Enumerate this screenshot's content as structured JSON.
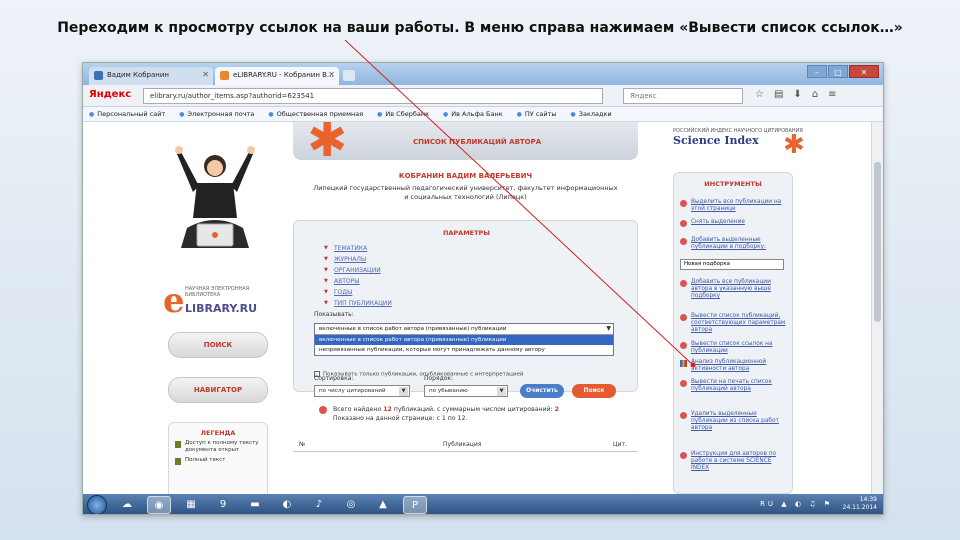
{
  "caption": "Переходим к просмотру ссылок на ваши работы. В меню справа нажимаем «Вывести список ссылок…»",
  "browser": {
    "tabs": [
      {
        "label": "Вадим Кобранин",
        "close": "✕"
      },
      {
        "label": "eLIBRARY.RU - Кобранин В...",
        "close": "✕"
      }
    ],
    "window_buttons": {
      "minimize": "–",
      "maximize": "□",
      "close": "✕"
    },
    "yandex": "Яндекс",
    "url": "elibrary.ru/author_items.asp?authorid=623541",
    "search_placeholder": "Яндекс",
    "bookmarks": [
      "Персональный сайт",
      "Электронная почта",
      "Общественная приемная",
      "Ив Сбербанк",
      "Ив Альфа Банк",
      "ПУ сайты",
      "Закладки"
    ]
  },
  "left": {
    "logo_tagline": "НАУЧНАЯ ЭЛЕКТРОННАЯ БИБЛИОТЕКА",
    "logo_e": "e",
    "logo_name": "LIBRARY.RU",
    "search_button": "ПОИСК",
    "navigator_button": "НАВИГАТОР",
    "legend_title": "ЛЕГЕНДА",
    "legend_items": [
      "Доступ к полному тексту документа открыт",
      "Полный текст"
    ]
  },
  "main": {
    "banner_title": "СПИСОК ПУБЛИКАЦИЙ АВТОРА",
    "author_name": "КОБРАНИН ВАДИМ ВАЛЕРЬЕВИЧ",
    "author_org": "Липецкий государственный педагогический университет, факультет информационных и социальных технологий (Липецк)",
    "params_title": "ПАРАМЕТРЫ",
    "param_links": [
      "ТЕМАТИКА",
      "ЖУРНАЛЫ",
      "ОРГАНИЗАЦИИ",
      "АВТОРЫ",
      "ГОДЫ",
      "ТИП ПУБЛИКАЦИИ"
    ],
    "show_label": "Показывать:",
    "select_current": "включенные в список работ автора (привязанные) публикации",
    "select_options": [
      "включенные в список работ автора (привязанные) публикации",
      "непривязанные публикации, которые могут принадлежать данному автору"
    ],
    "checkbox_label": "Показывать только публикации, опубликованные с интерпретацией",
    "sort_label": "Сортировка:",
    "sort_value": "по числу цитирований",
    "order_label": "Порядок:",
    "order_value": "по убыванию",
    "clear_button": "Очистить",
    "search_button": "Поиск",
    "found_line1_prefix": "Всего найдено ",
    "found_count": "12",
    "found_line1_suffix": " публикаций, с суммарным числом цитирований: ",
    "found_citations": "2",
    "found_line2": "Показано на данной странице: с 1 по 12.",
    "table_headers": [
      "№",
      "Публикация",
      "Цит."
    ]
  },
  "right": {
    "logo_small": "РОССИЙСКИЙ ИНДЕКС НАУЧНОГО ЦИТИРОВАНИЯ",
    "logo_big": "Science Index",
    "tools_title": "ИНСТРУМЕНТЫ",
    "tools": [
      "Выделить все публикации на этой странице",
      "Снять выделение",
      "Добавить выделенные публикации в подборку:",
      "Добавить все публикации автора в указанную выше подборку",
      "Вывести список публикаций, соответствующих параметрам автора",
      "Вывести список ссылок на публикации",
      "Анализ публикационной активности автора",
      "Вывести на печать список публикаций автора",
      "Удалить выделенные публикации из списка работ автора",
      "Инструкция для авторов по работе в системе SCIENCE INDEX"
    ],
    "tool_select_value": "Новая подборка"
  },
  "taskbar": {
    "icons": [
      "⊞",
      "☁",
      "◉",
      "▦",
      "9",
      "▬",
      "◐",
      "♪",
      "◎",
      "▲",
      "P"
    ],
    "tray_icons": "RU ▲ ◐ ♫ ⚑",
    "time": "14:39",
    "date": "24.11.2014"
  }
}
